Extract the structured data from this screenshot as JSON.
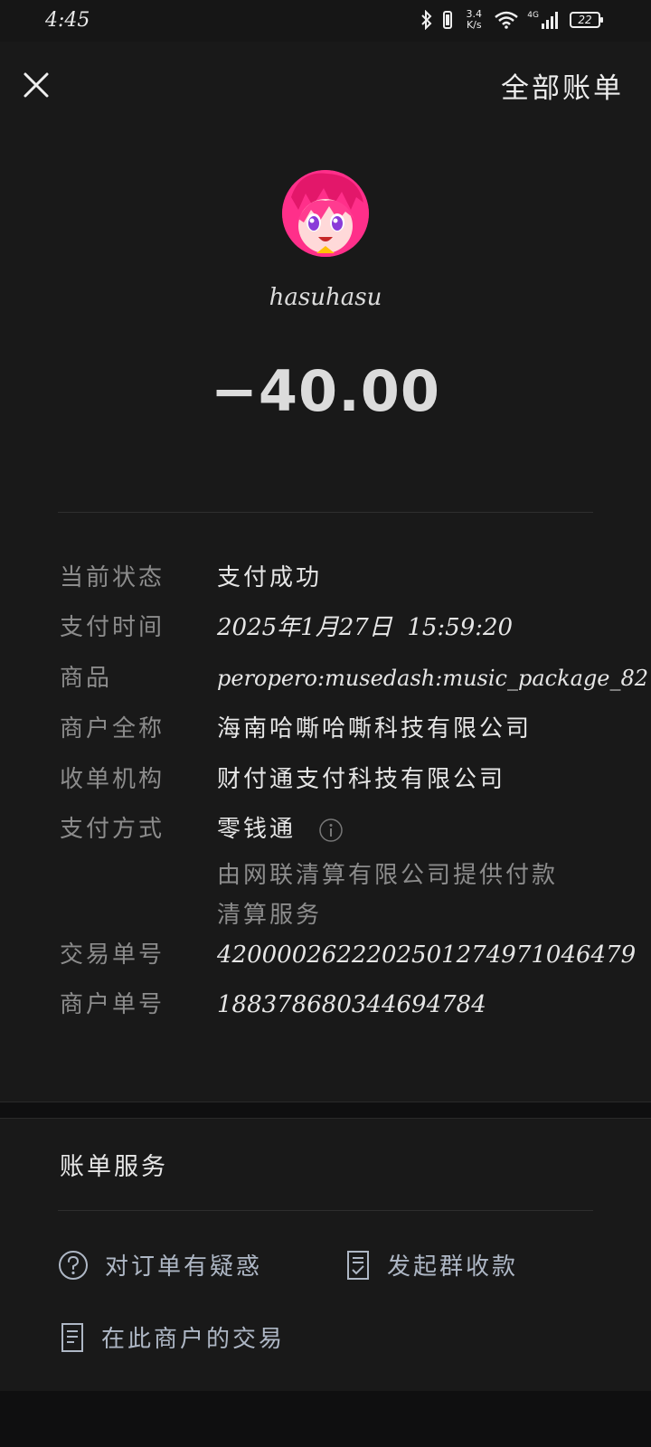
{
  "status_bar": {
    "time": "4:45",
    "net_speed_value": "3.4",
    "net_speed_unit": "K/s",
    "network_type": "4G",
    "battery": "22"
  },
  "header": {
    "all_bills_label": "全部账单"
  },
  "payee": {
    "name": "hasuhasu"
  },
  "amount": "−40.00",
  "details": {
    "status_label": "当前状态",
    "status_value": "支付成功",
    "time_label": "支付时间",
    "time_value": "2025年1月27日  15:59:20",
    "product_label": "商品",
    "product_value": "peropero:musedash:music_package_82",
    "merchant_label": "商户全称",
    "merchant_value": "海南哈嘶哈嘶科技有限公司",
    "acquirer_label": "收单机构",
    "acquirer_value": "财付通支付科技有限公司",
    "method_label": "支付方式",
    "method_value": "零钱通",
    "method_note": "由网联清算有限公司提供付款清算服务",
    "txn_label": "交易单号",
    "txn_value": "4200002622202501274971046479",
    "order_label": "商户单号",
    "order_value": "188378680344694784"
  },
  "services": {
    "title": "账单服务",
    "question": "对订单有疑惑",
    "group_collect": "发起群收款",
    "merchant_txns": "在此商户的交易"
  },
  "icons": {
    "close": "close-icon",
    "info": "info-icon",
    "question": "question-circle-icon",
    "group": "checklist-document-icon",
    "doc": "document-icon"
  },
  "colors": {
    "background": "#191919",
    "label_text": "#8c8c8c",
    "service_link": "#aeb7c5"
  }
}
